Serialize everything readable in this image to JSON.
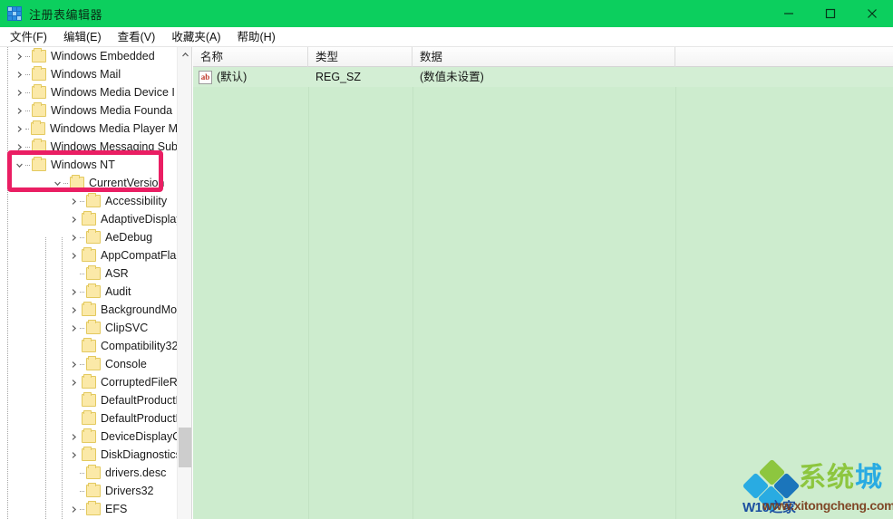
{
  "window": {
    "title": "注册表编辑器",
    "icon": "registry-icon",
    "titlebar_color": "#0ccf5e",
    "controls": {
      "minimize": "−",
      "maximize": "□",
      "close": "×"
    }
  },
  "menubar": {
    "items": [
      {
        "label": "文件(F)"
      },
      {
        "label": "编辑(E)"
      },
      {
        "label": "查看(V)"
      },
      {
        "label": "收藏夹(A)"
      },
      {
        "label": "帮助(H)"
      }
    ]
  },
  "tree": {
    "nodes": [
      {
        "label": "Windows Embedded",
        "level": 0,
        "expander": "collapsed"
      },
      {
        "label": "Windows Mail",
        "level": 0,
        "expander": "collapsed"
      },
      {
        "label": "Windows Media Device I",
        "level": 0,
        "expander": "collapsed"
      },
      {
        "label": "Windows Media Founda",
        "level": 0,
        "expander": "collapsed"
      },
      {
        "label": "Windows Media Player M",
        "level": 0,
        "expander": "collapsed"
      },
      {
        "label": "Windows Messaging Sub",
        "level": 0,
        "expander": "collapsed"
      },
      {
        "label": "Windows NT",
        "level": 0,
        "expander": "expanded"
      },
      {
        "label": "CurrentVersion",
        "level": 1,
        "expander": "expanded"
      },
      {
        "label": "Accessibility",
        "level": 2,
        "expander": "collapsed"
      },
      {
        "label": "AdaptiveDisplayBr",
        "level": 2,
        "expander": "collapsed"
      },
      {
        "label": "AeDebug",
        "level": 2,
        "expander": "collapsed"
      },
      {
        "label": "AppCompatFlags",
        "level": 2,
        "expander": "collapsed"
      },
      {
        "label": "ASR",
        "level": 2,
        "expander": "none"
      },
      {
        "label": "Audit",
        "level": 2,
        "expander": "collapsed"
      },
      {
        "label": "BackgroundMode",
        "level": 2,
        "expander": "collapsed"
      },
      {
        "label": "ClipSVC",
        "level": 2,
        "expander": "collapsed"
      },
      {
        "label": "Compatibility32",
        "level": 2,
        "expander": "none"
      },
      {
        "label": "Console",
        "level": 2,
        "expander": "collapsed"
      },
      {
        "label": "CorruptedFileReco",
        "level": 2,
        "expander": "collapsed"
      },
      {
        "label": "DefaultProductKey",
        "level": 2,
        "expander": "none"
      },
      {
        "label": "DefaultProductKey",
        "level": 2,
        "expander": "none"
      },
      {
        "label": "DeviceDisplayObje",
        "level": 2,
        "expander": "collapsed"
      },
      {
        "label": "DiskDiagnostics",
        "level": 2,
        "expander": "collapsed"
      },
      {
        "label": "drivers.desc",
        "level": 2,
        "expander": "none"
      },
      {
        "label": "Drivers32",
        "level": 2,
        "expander": "none"
      },
      {
        "label": "EFS",
        "level": 2,
        "expander": "collapsed"
      }
    ],
    "scrollbar": {
      "up_arrow": "chevron-up"
    }
  },
  "list": {
    "columns": [
      {
        "label": "名称"
      },
      {
        "label": "类型"
      },
      {
        "label": "数据"
      },
      {
        "label": ""
      }
    ],
    "rows": [
      {
        "icon": "ab-string-icon",
        "icon_text": "ab",
        "name": "(默认)",
        "type": "REG_SZ",
        "data": "(数值未设置)"
      }
    ],
    "background_color": "#cdecce"
  },
  "annotation": {
    "highlight_color": "#ea1e63",
    "target": "Windows NT / CurrentVersion"
  },
  "watermark": {
    "brand_green": "系统",
    "brand_blue": "城",
    "url": "www.xitongcheng.com",
    "overlay": "W10之家"
  }
}
